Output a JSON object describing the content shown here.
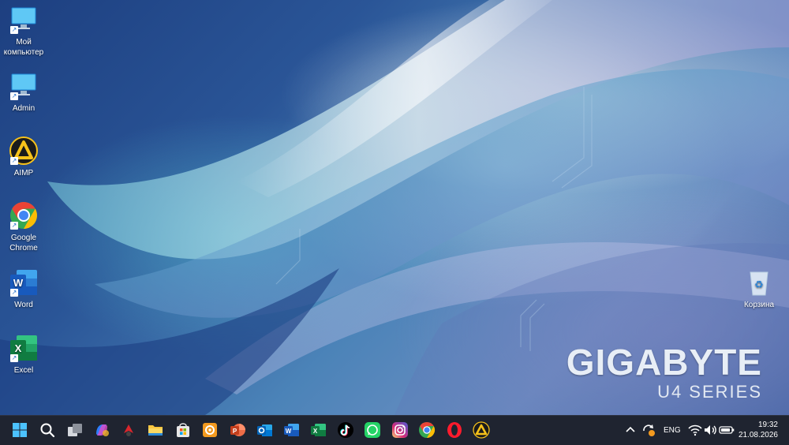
{
  "desktop": {
    "icons": [
      {
        "label_line1": "Мой",
        "label_line2": "компьютер",
        "icon": "computer-icon"
      },
      {
        "label": "Admin",
        "icon": "computer-icon"
      },
      {
        "label": "AIMP",
        "icon": "aimp-icon"
      },
      {
        "label_line1": "Google",
        "label_line2": "Chrome",
        "icon": "chrome-icon"
      },
      {
        "label": "Word",
        "icon": "word-icon"
      },
      {
        "label": "Excel",
        "icon": "excel-icon"
      },
      {
        "label": "Корзина",
        "icon": "recycle-bin-icon"
      }
    ]
  },
  "wallpaper": {
    "brand": "GIGABYTE",
    "series": "U4 SERIES"
  },
  "taskbar": {
    "pinned": [
      "start-icon",
      "search-icon",
      "task-view-icon",
      "copilot-icon",
      "game-icon",
      "file-explorer-icon",
      "microsoft-store-icon",
      "photos-icon",
      "powerpoint-icon",
      "outlook-icon",
      "word-icon",
      "excel-icon",
      "tiktok-icon",
      "whatsapp-icon",
      "instagram-icon",
      "chrome-icon",
      "opera-icon",
      "aimp-icon"
    ],
    "tray": {
      "language": "ENG",
      "time": "19:32",
      "date": "21.08.2026"
    }
  },
  "colors": {
    "taskbar_bg": "#1f2430",
    "word_blue": "#185abd",
    "excel_green": "#107c41",
    "chrome_red": "#ea4335",
    "chrome_yellow": "#fbbc05",
    "chrome_green": "#34a853",
    "chrome_blue": "#4285f4"
  }
}
